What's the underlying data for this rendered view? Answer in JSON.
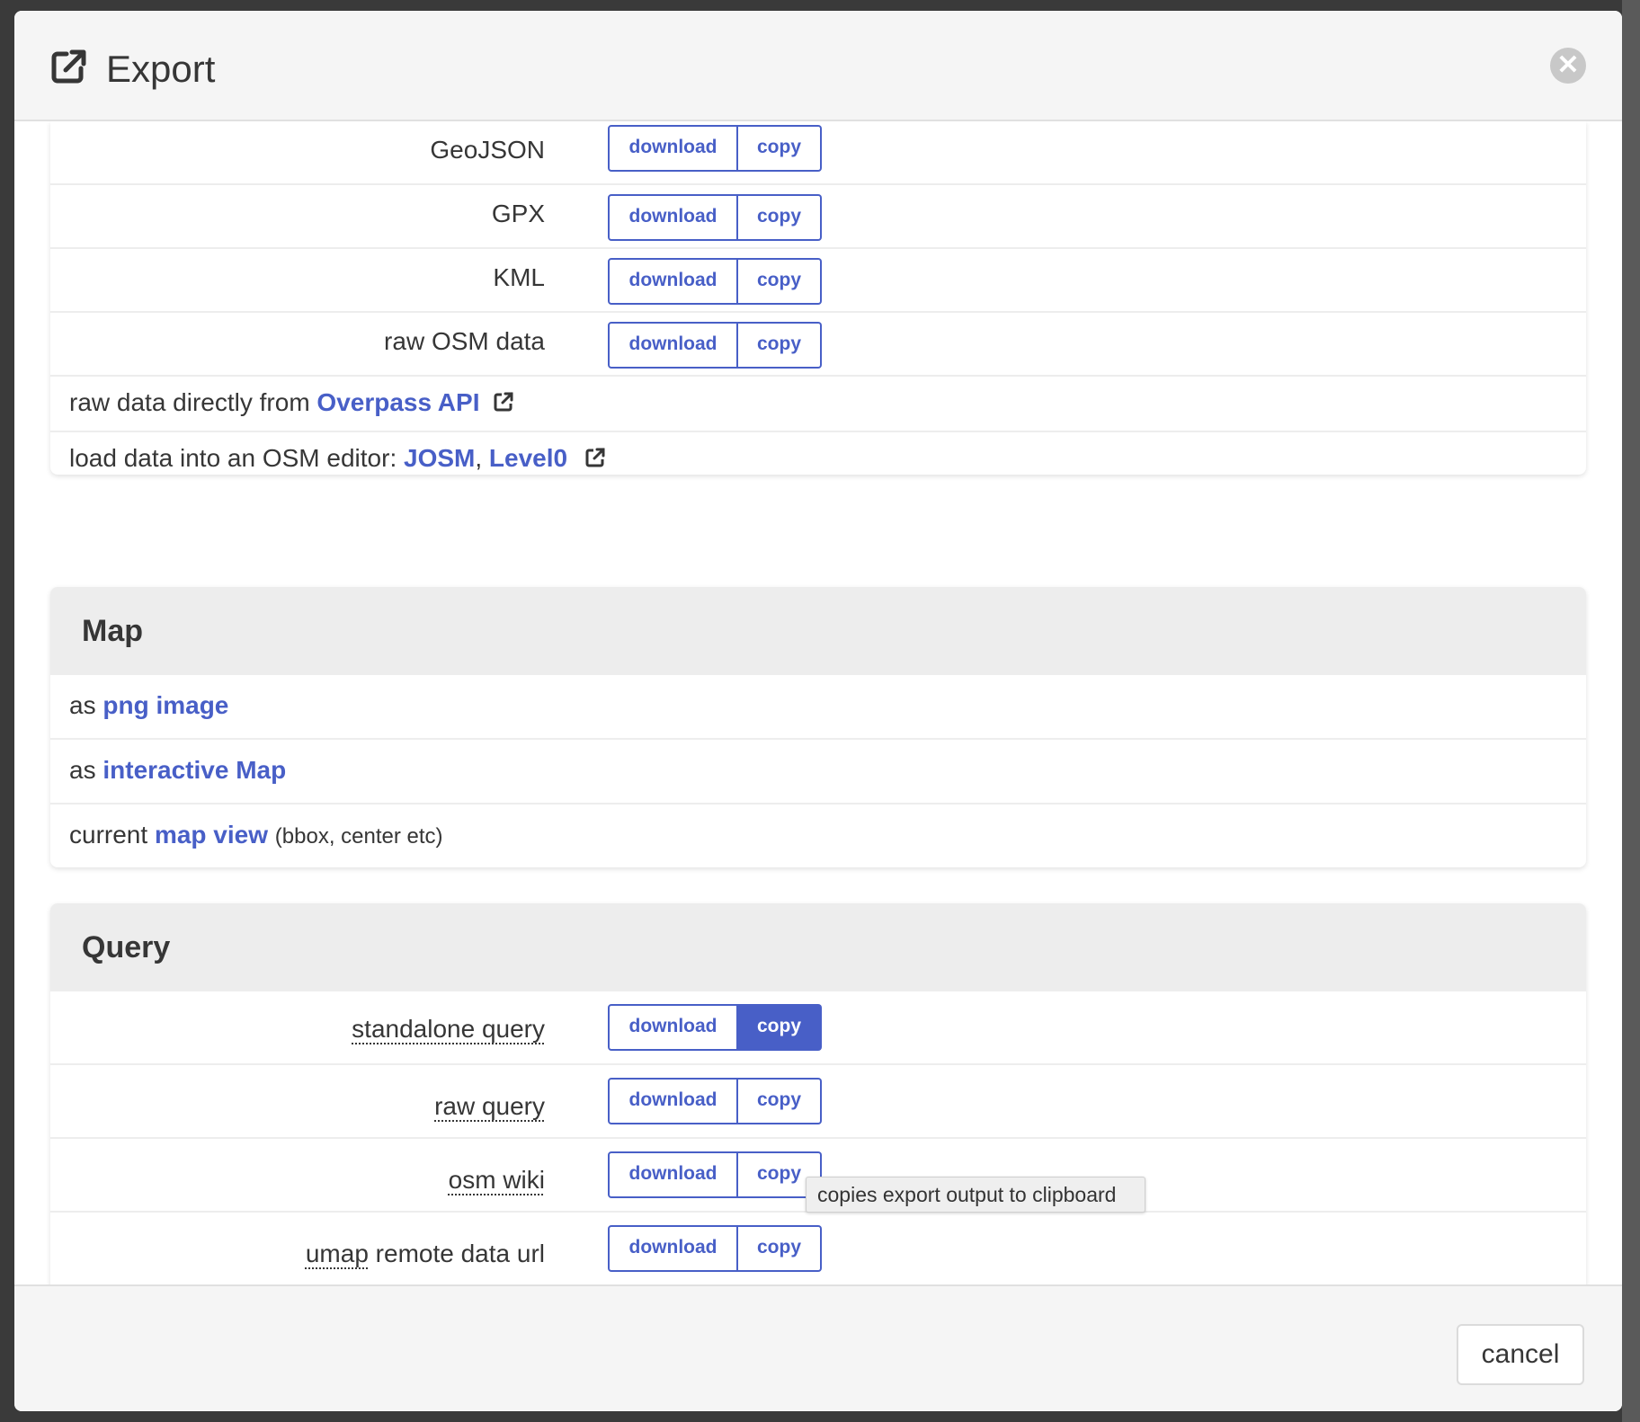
{
  "dialog": {
    "title": "Export",
    "cancel_label": "cancel"
  },
  "buttons": {
    "download": "download",
    "copy": "copy"
  },
  "data_section": {
    "formats": [
      "GeoJSON",
      "GPX",
      "KML",
      "raw OSM data"
    ],
    "overpass_row": {
      "prefix": "raw data directly from",
      "link": "Overpass API"
    },
    "editor_row": {
      "prefix": "load data into an OSM editor:",
      "josm": "JOSM",
      "separator": ",",
      "level0": "Level0"
    }
  },
  "map_section": {
    "heading": "Map",
    "png_row": {
      "prefix": "as",
      "link": "png image"
    },
    "interactive_row": {
      "prefix": "as",
      "link": "interactive Map"
    },
    "view_row": {
      "prefix": "current",
      "link": "map view",
      "suffix": "(bbox, center etc)"
    }
  },
  "query_section": {
    "heading": "Query",
    "items": [
      {
        "label": "standalone query"
      },
      {
        "label": "raw query"
      },
      {
        "label": "osm wiki"
      },
      {
        "label_abbr": "umap",
        "label_rest": "remote data url"
      }
    ]
  },
  "tooltip": "copies export output to clipboard",
  "colors": {
    "link": "#485fc7",
    "heading_bg": "#ededed",
    "active_button_bg": "#485fc7"
  },
  "icons": {
    "title": "external-link-icon",
    "close": "close-icon"
  }
}
